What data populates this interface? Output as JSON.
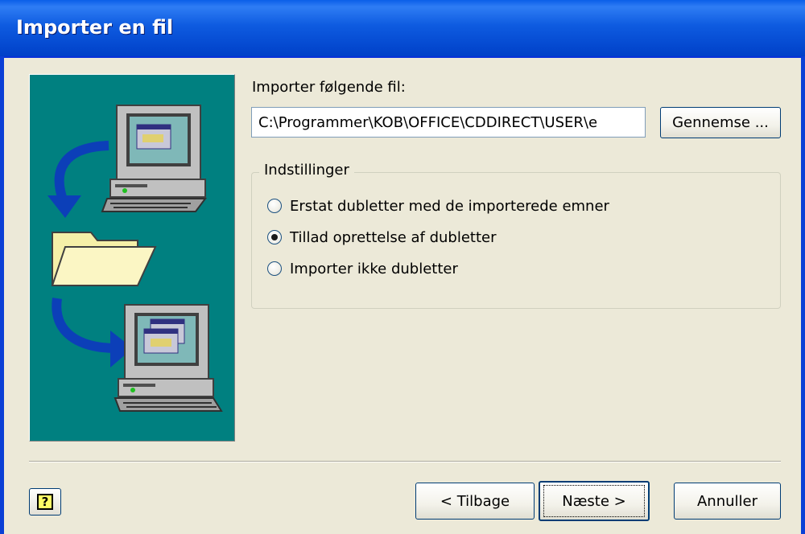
{
  "window": {
    "title": "Importer en fil"
  },
  "file": {
    "label": "Importer følgende fil:",
    "value": "C:\\Programmer\\KOB\\OFFICE\\CDDIRECT\\USER\\e",
    "browse_label": "Gennemse ..."
  },
  "options": {
    "group_title": "Indstillinger",
    "items": [
      {
        "label": "Erstat dubletter med de importerede emner",
        "checked": false
      },
      {
        "label": "Tillad oprettelse af dubletter",
        "checked": true
      },
      {
        "label": "Importer ikke dubletter",
        "checked": false
      }
    ]
  },
  "footer": {
    "help_icon": "help-icon",
    "back_label": "< Tilbage",
    "next_label": "Næste >",
    "cancel_label": "Annuller"
  },
  "colors": {
    "title_bar": "#0a5ee8",
    "illustration_bg": "#008080",
    "dialog_bg": "#ece9d8"
  }
}
